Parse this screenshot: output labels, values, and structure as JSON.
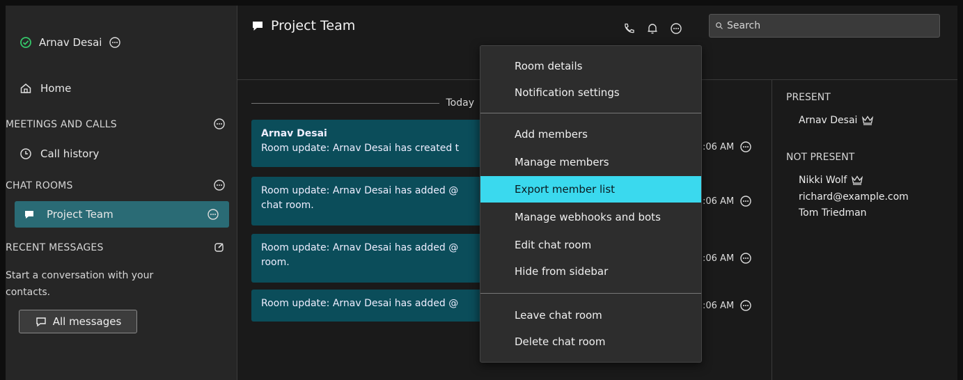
{
  "user": {
    "name": "Arnav Desai",
    "status": "online"
  },
  "sidebar": {
    "home_label": "Home",
    "meetings_heading": "MEETINGS AND CALLS",
    "call_history_label": "Call history",
    "chat_rooms_heading": "CHAT ROOMS",
    "rooms": [
      {
        "label": "Project Team",
        "selected": true
      }
    ],
    "recent_heading": "RECENT MESSAGES",
    "recent_empty_text": "Start a conversation with your contacts.",
    "all_messages_label": "All messages"
  },
  "header": {
    "room_title": "Project Team",
    "search_placeholder": "Search",
    "icons": [
      "phone-icon",
      "bell-icon",
      "more-icon"
    ]
  },
  "chat": {
    "day_label": "Today",
    "messages": [
      {
        "author": "Arnav Desai",
        "text": "Room update: Arnav Desai has created t",
        "time": ":06 AM"
      },
      {
        "author": "",
        "text": "Room update: Arnav Desai has added @",
        "text2": "chat room.",
        "time": ":06 AM"
      },
      {
        "author": "",
        "text": "Room update: Arnav Desai has added @",
        "text2": "room.",
        "time": ":06 AM"
      },
      {
        "author": "",
        "text": "Room update: Arnav Desai has added @",
        "time": ":06 AM"
      }
    ]
  },
  "menu": {
    "items": [
      "Room details",
      "Notification settings",
      "Add members",
      "Manage members",
      "Export member list",
      "Manage webhooks and bots",
      "Edit chat room",
      "Hide from sidebar",
      "Leave chat room",
      "Delete chat room"
    ],
    "highlighted": "Export member list"
  },
  "members": {
    "present_heading": "PRESENT",
    "present": [
      {
        "name": "Arnav Desai",
        "moderator": true
      }
    ],
    "not_present_heading": "NOT PRESENT",
    "not_present": [
      {
        "name": "Nikki Wolf",
        "moderator": true
      },
      {
        "name": "richard@example.com",
        "moderator": false
      },
      {
        "name": "Tom Triedman",
        "moderator": false
      }
    ]
  },
  "colors": {
    "accent": "#3ad9ee",
    "selected_room": "#2a6b75",
    "bubble": "#0b4d5a",
    "status_green": "#35c76a"
  }
}
